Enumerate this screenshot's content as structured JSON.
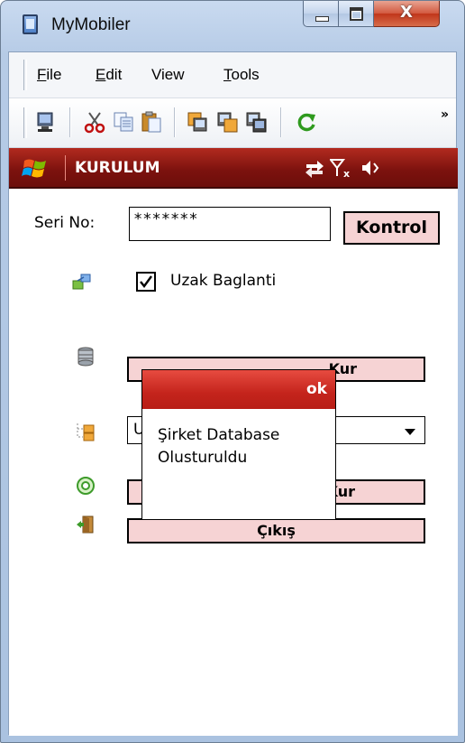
{
  "window": {
    "title": "MyMobiler",
    "controls": {
      "minimize": "minimize",
      "maximize": "maximize",
      "close_glyph": "X"
    }
  },
  "menubar": {
    "items": [
      {
        "label": "File",
        "accel": "F",
        "rest": "ile"
      },
      {
        "label": "Edit",
        "accel": "E",
        "rest": "dit"
      },
      {
        "label": "View",
        "accel": "",
        "rest": "View"
      },
      {
        "label": "Tools",
        "accel": "T",
        "rest": "ools"
      }
    ]
  },
  "toolbar": {
    "icons": [
      "device-icon",
      "cut-icon",
      "copy-icon",
      "paste-icon",
      "copy-to-device-icon",
      "copy-from-device-icon",
      "screenshot-icon",
      "refresh-icon"
    ],
    "overflow": "»"
  },
  "device": {
    "title_bar": {
      "title": "KURULUM",
      "status_icons": [
        "connectivity-icon",
        "no-signal-icon",
        "volume-icon"
      ],
      "color": "#8a1711"
    },
    "serial": {
      "label": "Seri No:",
      "value": "*******",
      "check_button": "Kontrol"
    },
    "remote": {
      "label": "Uzak Baglanti",
      "checked": true
    },
    "buttons": {
      "create_db": "Kur",
      "install_company": "Kur",
      "exit": "Çıkış"
    },
    "combo": {
      "value": "U"
    },
    "button_color": "#f6d3d4"
  },
  "popup": {
    "header": "ok",
    "message_line1": "Şirket Database",
    "message_line2": "Olusturuldu",
    "header_color": "#d1312a"
  }
}
